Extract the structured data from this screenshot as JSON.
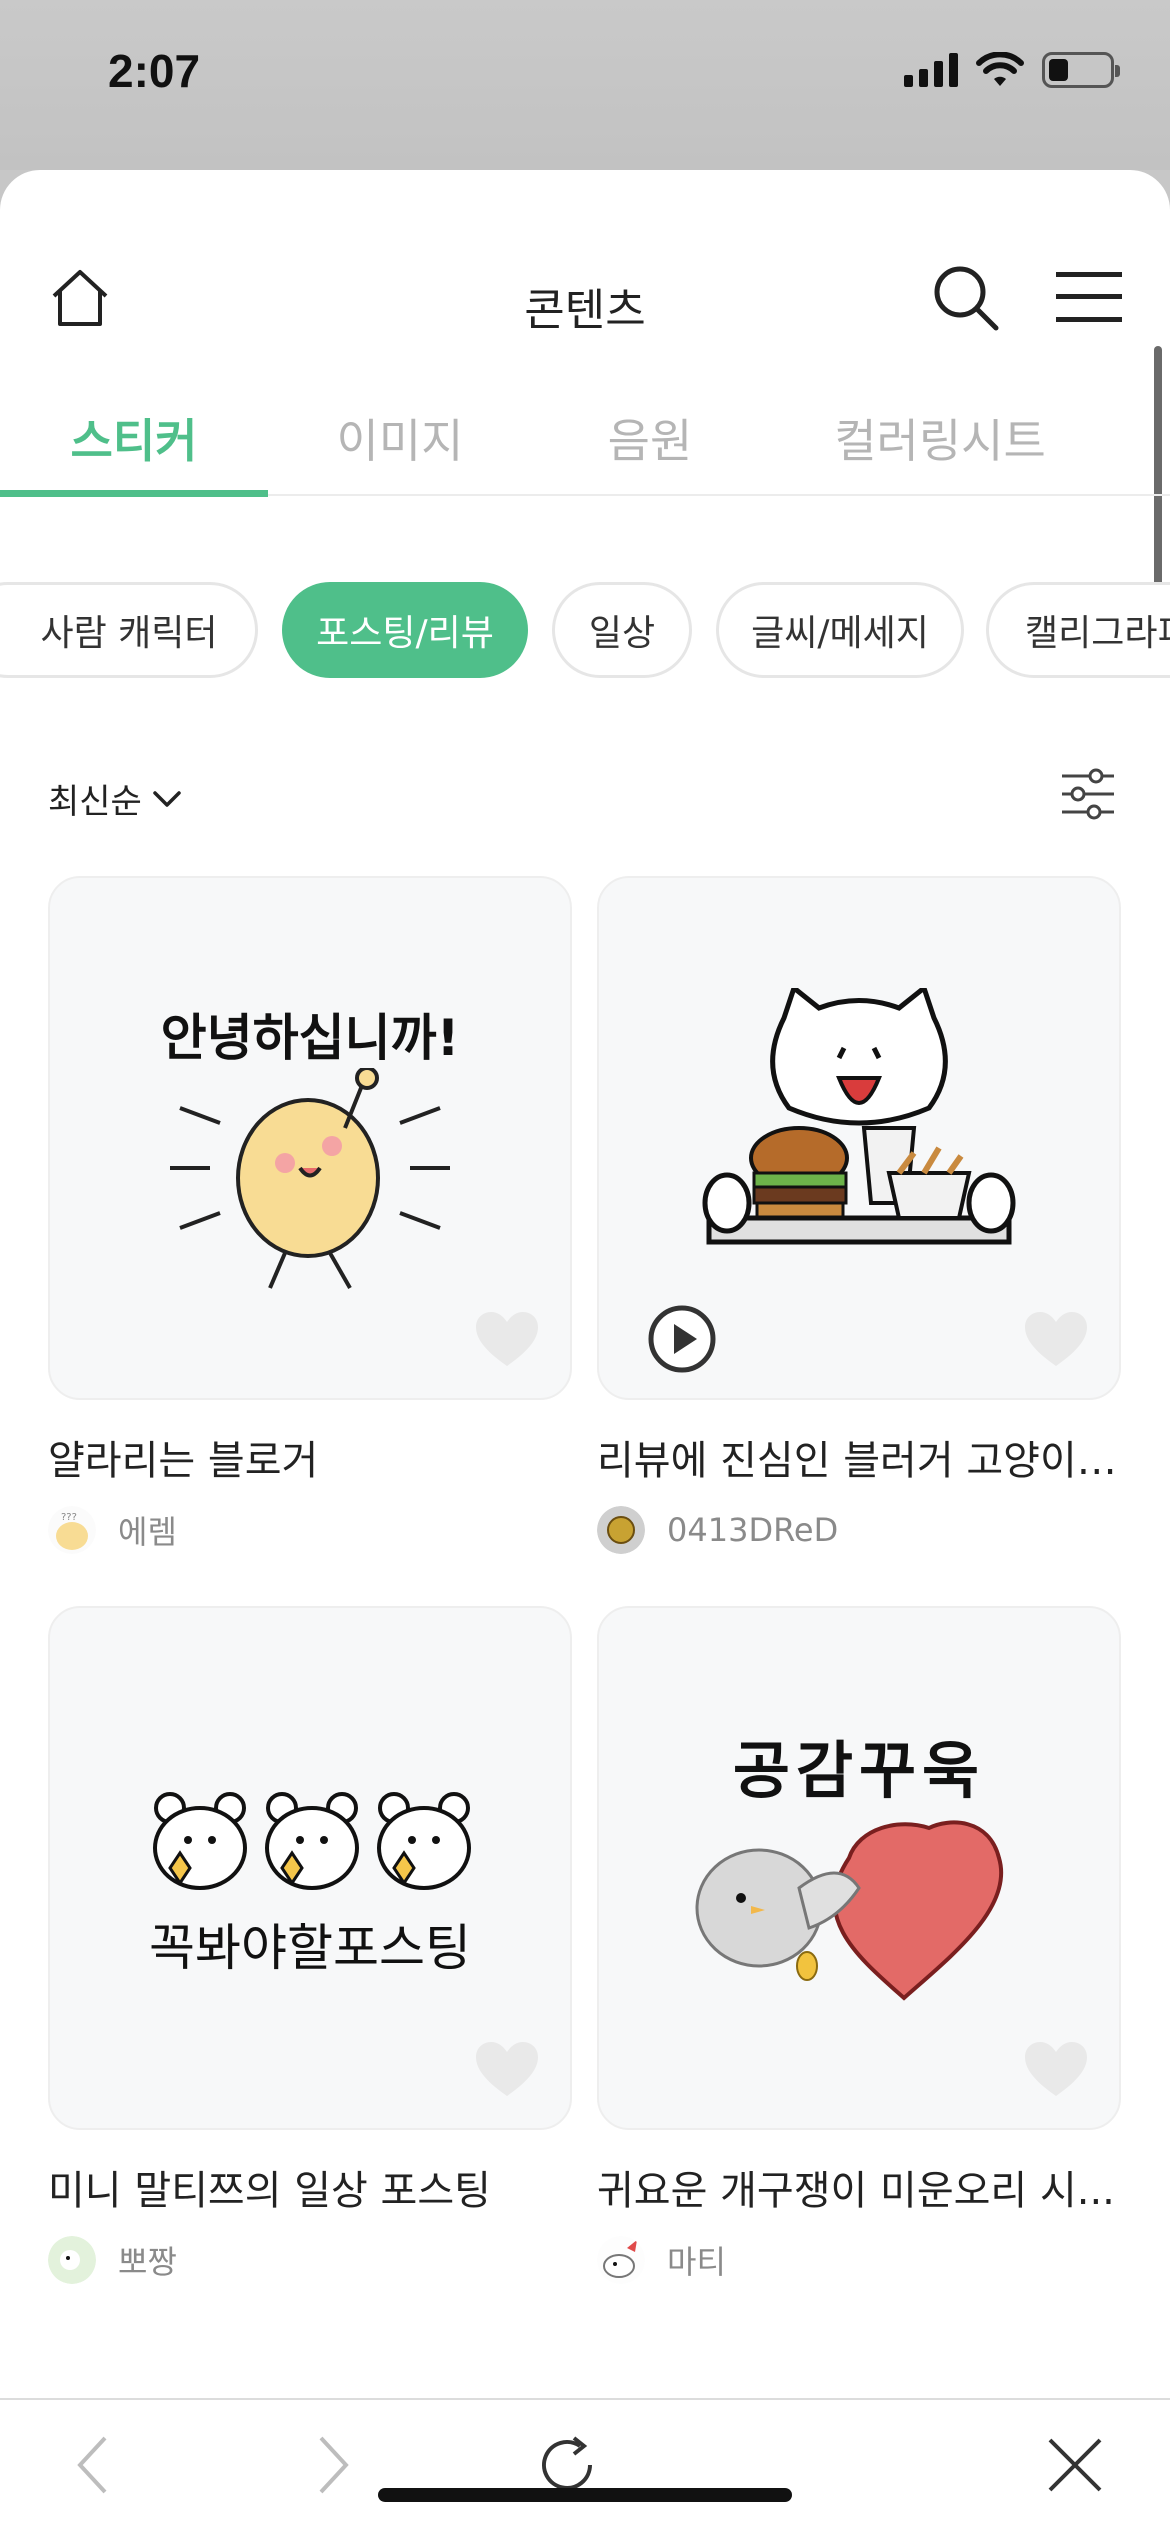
{
  "status_bar": {
    "time": "2:07",
    "battery_level": 0.3
  },
  "header": {
    "title": "콘텐츠"
  },
  "tabs": [
    {
      "label": "스티커",
      "active": true
    },
    {
      "label": "이미지",
      "active": false
    },
    {
      "label": "음원",
      "active": false
    },
    {
      "label": "컬러링시트",
      "active": false
    }
  ],
  "chips": [
    {
      "label": "사람 캐릭터",
      "active": false
    },
    {
      "label": "포스팅/리뷰",
      "active": true
    },
    {
      "label": "일상",
      "active": false
    },
    {
      "label": "글씨/메세지",
      "active": false
    },
    {
      "label": "캘리그라피",
      "active": false
    }
  ],
  "sort": {
    "label": "최신순"
  },
  "cards": [
    {
      "title": "얄라리는 블로거",
      "author": "에렘",
      "sticker_text": "안녕하십니까!",
      "has_play": false
    },
    {
      "title": "리뷰에 진심인 블러거 고양이 ...",
      "author": "0413DReD",
      "sticker_text": "",
      "has_play": true
    },
    {
      "title": "미니 말티쯔의 일상 포스팅",
      "author": "뽀짱",
      "sticker_text": "꼭봐야할포스팅",
      "has_play": false
    },
    {
      "title": "귀요운 개구쟁이 미운오리 시...",
      "author": "마티",
      "sticker_text": "공감꾸욱",
      "has_play": false
    }
  ],
  "colors": {
    "accent": "#4fbf8a",
    "heart": "#e9e9e9"
  }
}
